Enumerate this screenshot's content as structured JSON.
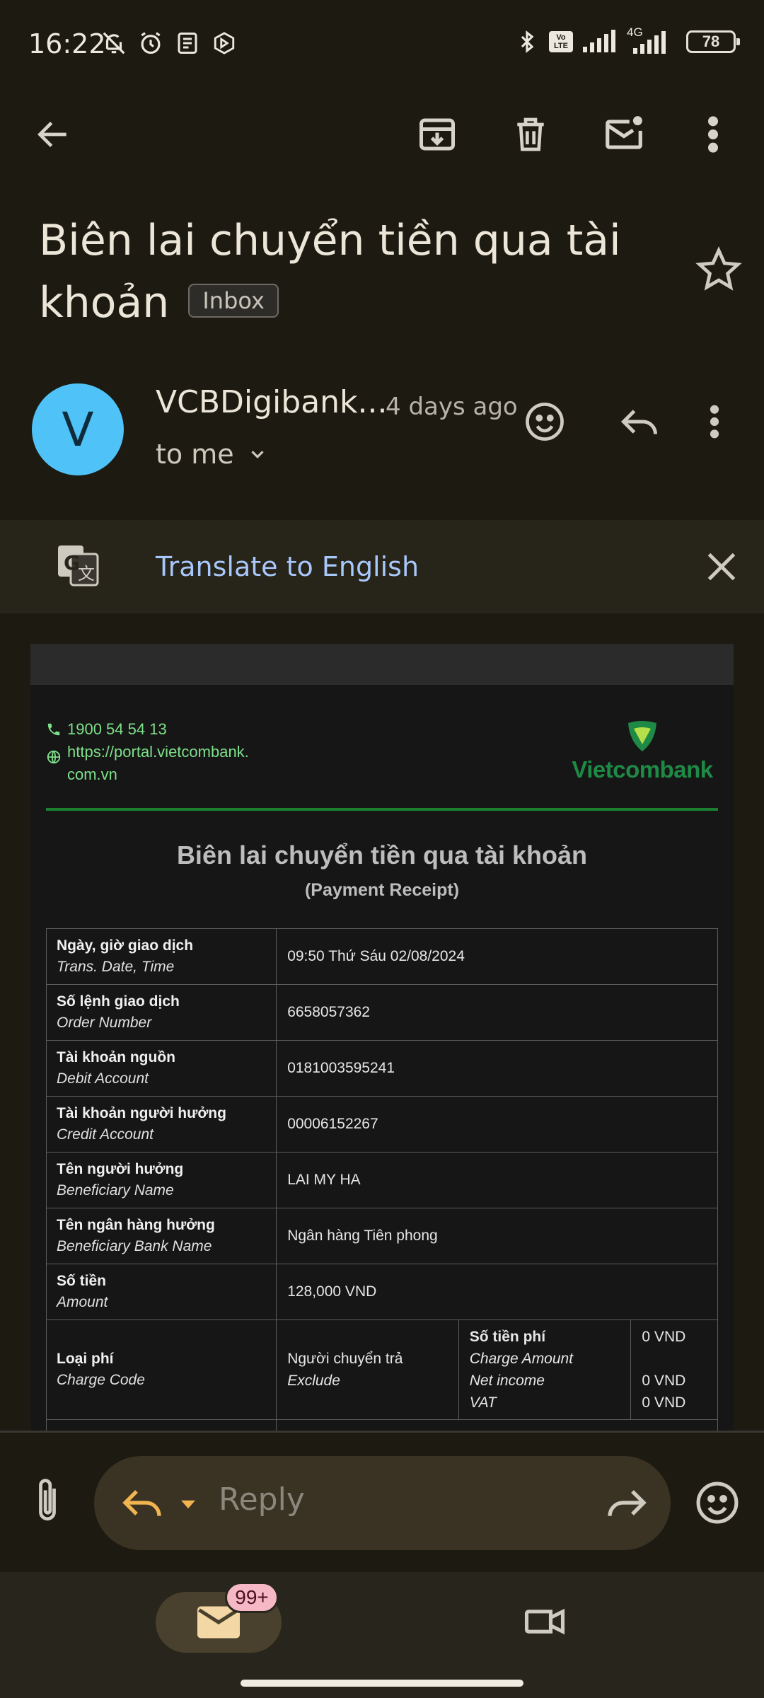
{
  "status_bar": {
    "time": "16:22",
    "icons_left": [
      "mute-icon",
      "alarm-icon",
      "news-icon",
      "bing-icon"
    ],
    "icons_right": [
      "bluetooth-icon",
      "volte-icon",
      "signal-icon",
      "4g-signal-icon"
    ],
    "network": "4G",
    "volte": "Vo LTE",
    "battery": "78"
  },
  "toolbar": {
    "back": "back-arrow-icon",
    "archive": "archive-icon",
    "delete": "trash-icon",
    "mark_unread": "mark-unread-icon",
    "more": "more-vert-icon"
  },
  "subject": {
    "text": "Biên lai chuyển tiền qua tài khoản",
    "label": "Inbox"
  },
  "message_header": {
    "avatar_letter": "V",
    "avatar_color": "#4fc3f7",
    "sender": "VCBDigibank...",
    "time": "4 days ago",
    "recipient": "to me"
  },
  "translate": {
    "text": "Translate to English"
  },
  "email": {
    "phone": "1900 54 54 13",
    "website": "https://portal.vietcombank.com.vn",
    "website_line1": "https://portal.vietcombank.",
    "website_line2": "com.vn",
    "brand": "Vietcombank",
    "brand_color": "#1e8a45",
    "title": "Biên lai chuyển tiền qua tài khoản",
    "subtitle": "(Payment Receipt)",
    "rows": [
      {
        "vi": "Ngày, giờ giao dịch",
        "en": "Trans. Date, Time",
        "value": "09:50 Thứ Sáu 02/08/2024"
      },
      {
        "vi": "Số lệnh giao dịch",
        "en": "Order Number",
        "value": "6658057362"
      },
      {
        "vi": "Tài khoản nguồn",
        "en": "Debit Account",
        "value": "0181003595241"
      },
      {
        "vi": "Tài khoản người hưởng",
        "en": "Credit Account",
        "value": "00006152267"
      },
      {
        "vi": "Tên người hưởng",
        "en": "Beneficiary Name",
        "value": "LAI MY HA"
      },
      {
        "vi": "Tên ngân hàng hưởng",
        "en": "Beneficiary Bank Name",
        "value": "Ngân hàng Tiên phong"
      },
      {
        "vi": "Số tiền",
        "en": "Amount",
        "value": "128,000 VND"
      }
    ],
    "charge": {
      "vi": "Loại phí",
      "en": "Charge Code",
      "type_vi": "Người chuyển trả",
      "type_en": "Exclude",
      "fee_label_vi": "Số tiền phí",
      "fee_label_en": "Charge Amount",
      "net_income": "Net income",
      "vat": "VAT",
      "fee_amount": "0 VND",
      "net_income_value": "0 VND",
      "vat_value": "0 VND"
    }
  },
  "reply_bar": {
    "placeholder": "Reply"
  },
  "bottom_nav": {
    "mail_badge": "99+"
  }
}
